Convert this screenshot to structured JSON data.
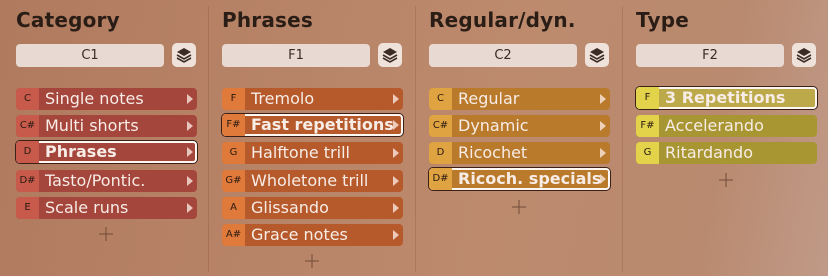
{
  "columns": [
    {
      "title": "Category",
      "selector": "C1",
      "items": [
        {
          "key": "C",
          "label": "Single notes"
        },
        {
          "key": "C#",
          "label": "Multi shorts"
        },
        {
          "key": "D",
          "label": "Phrases",
          "selected": true
        },
        {
          "key": "D#",
          "label": "Tasto/Pontic."
        },
        {
          "key": "E",
          "label": "Scale runs"
        }
      ]
    },
    {
      "title": "Phrases",
      "selector": "F1",
      "items": [
        {
          "key": "F",
          "label": "Tremolo"
        },
        {
          "key": "F#",
          "label": "Fast repetitions",
          "selected": true
        },
        {
          "key": "G",
          "label": "Halftone trill"
        },
        {
          "key": "G#",
          "label": "Wholetone trill"
        },
        {
          "key": "A",
          "label": "Glissando"
        },
        {
          "key": "A#",
          "label": "Grace notes"
        }
      ]
    },
    {
      "title": "Regular/dyn.",
      "selector": "C2",
      "items": [
        {
          "key": "C",
          "label": "Regular"
        },
        {
          "key": "C#",
          "label": "Dynamic"
        },
        {
          "key": "D",
          "label": "Ricochet"
        },
        {
          "key": "D#",
          "label": "Ricoch. specials",
          "selected": true
        }
      ]
    },
    {
      "title": "Type",
      "selector": "F2",
      "items": [
        {
          "key": "F",
          "label": "3 Repetitions",
          "selected": true
        },
        {
          "key": "F#",
          "label": "Accelerando"
        },
        {
          "key": "G",
          "label": "Ritardando"
        }
      ]
    }
  ],
  "icons": {
    "layers": "layers-icon",
    "arrow": "chevron-right-icon",
    "add": "plus-icon"
  },
  "theme_colors": {
    "category": "#a5463c",
    "phrases": "#b65a2c",
    "regular": "#b97a2c",
    "type": "#a89632",
    "selected_border": "#fdf6f1"
  }
}
